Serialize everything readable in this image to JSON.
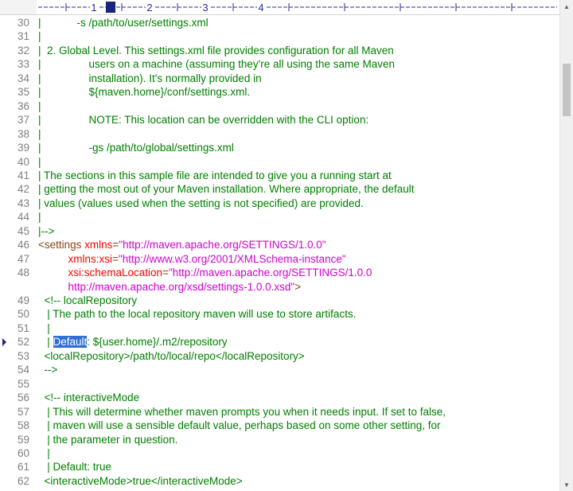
{
  "ruler": {
    "labels": [
      "1",
      "2",
      "3",
      "4"
    ]
  },
  "editor": {
    "current_line": "52",
    "lines": [
      {
        "n": "30",
        "segs": [
          {
            "t": "|            -s /path/to/user/settings.xml",
            "c": "c"
          }
        ]
      },
      {
        "n": "31",
        "segs": [
          {
            "t": "|",
            "c": "c"
          }
        ]
      },
      {
        "n": "32",
        "segs": [
          {
            "t": "|  2. Global Level. This settings.xml file provides configuration for all Maven",
            "c": "c"
          }
        ]
      },
      {
        "n": "33",
        "segs": [
          {
            "t": "|                users on a machine (assuming they're all using the same Maven",
            "c": "c"
          }
        ]
      },
      {
        "n": "34",
        "segs": [
          {
            "t": "|                installation). It's normally provided in",
            "c": "c"
          }
        ]
      },
      {
        "n": "35",
        "segs": [
          {
            "t": "|                ${maven.home}/conf/settings.xml.",
            "c": "c"
          }
        ]
      },
      {
        "n": "36",
        "segs": [
          {
            "t": "|",
            "c": "c"
          }
        ]
      },
      {
        "n": "37",
        "segs": [
          {
            "t": "|                NOTE: This location can be overridden with the CLI option:",
            "c": "c"
          }
        ]
      },
      {
        "n": "38",
        "segs": [
          {
            "t": "|",
            "c": "c"
          }
        ]
      },
      {
        "n": "39",
        "segs": [
          {
            "t": "|                -gs /path/to/global/settings.xml",
            "c": "c"
          }
        ]
      },
      {
        "n": "40",
        "segs": [
          {
            "t": "|",
            "c": "c"
          }
        ]
      },
      {
        "n": "41",
        "segs": [
          {
            "t": "| The sections in this sample file are intended to give you a running start at",
            "c": "c"
          }
        ]
      },
      {
        "n": "42",
        "segs": [
          {
            "t": "| getting the most out of your Maven installation. Where appropriate, the default",
            "c": "c"
          }
        ]
      },
      {
        "n": "43",
        "segs": [
          {
            "t": "| values (values used when the setting is not specified) are provided.",
            "c": "c"
          }
        ]
      },
      {
        "n": "44",
        "segs": [
          {
            "t": "|",
            "c": "c"
          }
        ]
      },
      {
        "n": "45",
        "segs": [
          {
            "t": "|-->",
            "c": "c"
          }
        ]
      },
      {
        "n": "46",
        "segs": [
          {
            "t": "<settings ",
            "c": "t"
          },
          {
            "t": "xmlns",
            "c": "a"
          },
          {
            "t": "=",
            "c": "t"
          },
          {
            "t": "\"http://maven.apache.org/SETTINGS/1.0.0\"",
            "c": "v"
          }
        ]
      },
      {
        "n": "47",
        "segs": [
          {
            "t": "          xmlns:xsi",
            "c": "a"
          },
          {
            "t": "=",
            "c": "t"
          },
          {
            "t": "\"http://www.w3.org/2001/XMLSchema-instance\"",
            "c": "v"
          }
        ]
      },
      {
        "n": "48",
        "segs": [
          {
            "t": "          xsi:schemaLocation",
            "c": "a"
          },
          {
            "t": "=",
            "c": "t"
          },
          {
            "t": "\"http://maven.apache.org/SETTINGS/1.0.0",
            "c": "v"
          }
        ]
      },
      {
        "n": "",
        "segs": [
          {
            "t": "          http://maven.apache.org/xsd/settings-1.0.0.xsd\"",
            "c": "v"
          },
          {
            "t": ">",
            "c": "t"
          }
        ]
      },
      {
        "n": "49",
        "segs": [
          {
            "t": "  <!-- localRepository",
            "c": "c"
          }
        ]
      },
      {
        "n": "50",
        "segs": [
          {
            "t": "   | The path to the local repository maven will use to store artifacts.",
            "c": "c"
          }
        ]
      },
      {
        "n": "51",
        "segs": [
          {
            "t": "   |",
            "c": "c"
          }
        ]
      },
      {
        "n": "52",
        "segs": [
          {
            "t": "   | ",
            "c": "c"
          },
          {
            "t": "Default",
            "c": "sel"
          },
          {
            "t": ": ${user.home}/.m2/repository",
            "c": "c"
          }
        ]
      },
      {
        "n": "53",
        "segs": [
          {
            "t": "  <localRepository>/path/to/local/repo</localRepository>",
            "c": "c"
          }
        ]
      },
      {
        "n": "54",
        "segs": [
          {
            "t": "  -->",
            "c": "c"
          }
        ]
      },
      {
        "n": "55",
        "segs": [
          {
            "t": "",
            "c": "c"
          }
        ]
      },
      {
        "n": "56",
        "segs": [
          {
            "t": "  <!-- interactiveMode",
            "c": "c"
          }
        ]
      },
      {
        "n": "57",
        "segs": [
          {
            "t": "   | This will determine whether maven prompts you when it needs input. If set to false,",
            "c": "c"
          }
        ]
      },
      {
        "n": "58",
        "segs": [
          {
            "t": "   | maven will use a sensible default value, perhaps based on some other setting, for",
            "c": "c"
          }
        ]
      },
      {
        "n": "59",
        "segs": [
          {
            "t": "   | the parameter in question.",
            "c": "c"
          }
        ]
      },
      {
        "n": "60",
        "segs": [
          {
            "t": "   |",
            "c": "c"
          }
        ]
      },
      {
        "n": "61",
        "segs": [
          {
            "t": "   | Default: true",
            "c": "c"
          }
        ]
      },
      {
        "n": "62",
        "segs": [
          {
            "t": "  <interactiveMode>true</interactiveMode>",
            "c": "c"
          }
        ]
      }
    ]
  },
  "colors": {
    "comment": "#008000",
    "tag": "#8b4513",
    "attribute": "#ff0000",
    "value": "#d000d0",
    "line_number": "#808080",
    "selection": "#2f6fd6",
    "ruler": "#2a2a9a"
  },
  "scrollbar": {
    "up_icon": "arrow-up-icon",
    "down_icon": "arrow-down-icon"
  }
}
